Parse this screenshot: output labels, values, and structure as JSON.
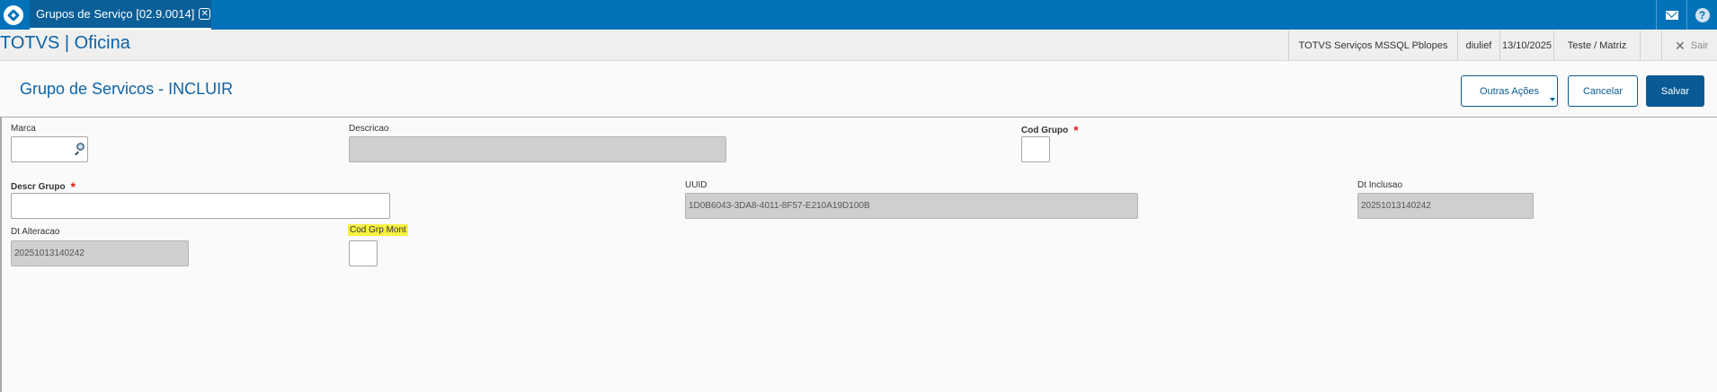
{
  "topbar": {
    "tab_title": "Grupos de Serviço [02.9.0014]",
    "tab_close_glyph": "✕",
    "icons": [
      "logo-icon",
      "mail-icon",
      "help-icon"
    ],
    "accent_color": "#0172b8"
  },
  "appbar": {
    "title": "TOTVS | Oficina",
    "environment": "TOTVS Serviços MSSQL Pblopes",
    "user": "diulief",
    "date": "13/10/2025",
    "branch": "Teste / Matriz",
    "logout_label": "Sair"
  },
  "page": {
    "title": "Grupo de Servicos - INCLUIR",
    "buttons": {
      "more_actions": "Outras Ações",
      "cancel": "Cancelar",
      "save": "Salvar"
    }
  },
  "form": {
    "marca": {
      "label": "Marca",
      "value": ""
    },
    "descricao": {
      "label": "Descricao",
      "value": ""
    },
    "cod_grupo": {
      "label": "Cod Grupo",
      "required": "*",
      "value": ""
    },
    "descr_grupo": {
      "label": "Descr Grupo",
      "required": "*",
      "value": ""
    },
    "uuid": {
      "label": "UUID",
      "value": "1D0B6043-3DA8-4011-8F57-E210A19D100B"
    },
    "dt_inclusao": {
      "label": "Dt Inclusao",
      "value": "20251013140242"
    },
    "dt_alteracao": {
      "label": "Dt Alteracao",
      "value": "20251013140242"
    },
    "cod_grp_mont": {
      "label": "Cod Grp Mont",
      "value": ""
    }
  }
}
